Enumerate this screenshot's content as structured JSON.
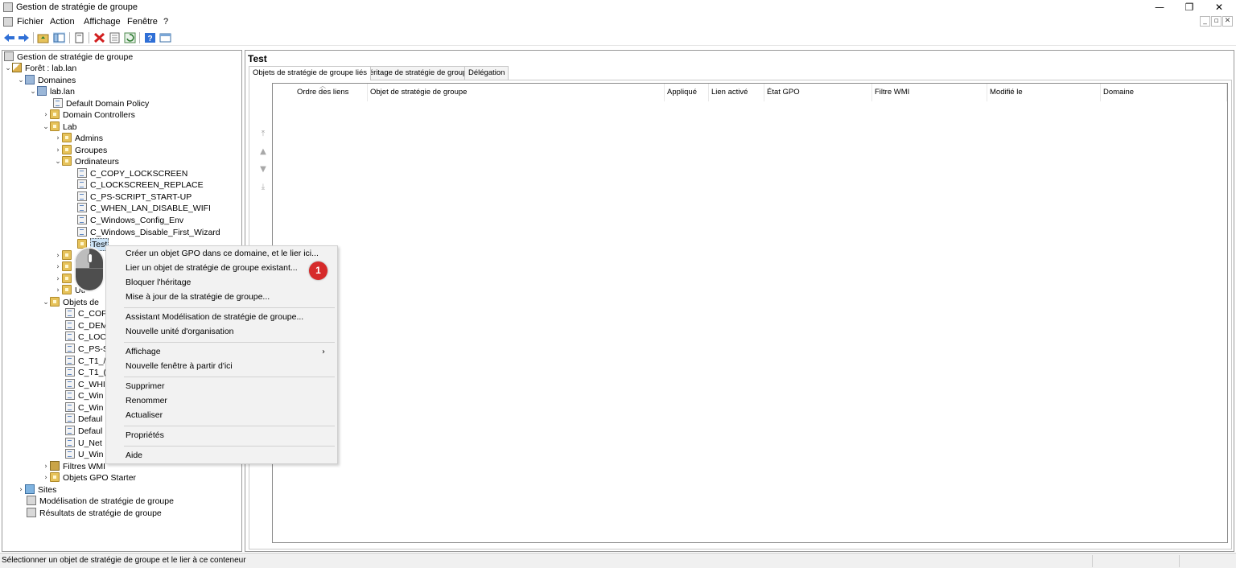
{
  "window": {
    "title": "Gestion de stratégie de groupe",
    "controls": {
      "minimize": "—",
      "restore": "❐",
      "close": "✕"
    }
  },
  "menubar": {
    "items": [
      "Fichier",
      "Action",
      "Affichage",
      "Fenêtre",
      "?"
    ],
    "mdi_controls": [
      "_",
      "▫",
      "✕"
    ]
  },
  "toolbar": {
    "buttons": [
      "back-arrow-icon",
      "forward-arrow-icon",
      "up-folder-icon",
      "show-tree-icon",
      "copy-icon",
      "delete-icon",
      "properties-icon",
      "refresh-icon",
      "help-icon",
      "console-icon"
    ]
  },
  "tree": {
    "root": "Gestion de stratégie de groupe",
    "forest": "Forêt : lab.lan",
    "domains": "Domaines",
    "domain": "lab.lan",
    "default_policy": "Default Domain Policy",
    "domain_controllers": "Domain Controllers",
    "lab": "Lab",
    "admins": "Admins",
    "groupes": "Groupes",
    "ordinateurs": "Ordinateurs",
    "ordinateurs_gpos": [
      "C_COPY_LOCKSCREEN",
      "C_LOCKSCREEN_REPLACE",
      "C_PS-SCRIPT_START-UP",
      "C_WHEN_LAN_DISABLE_WIFI",
      "C_Windows_Config_Env",
      "C_Windows_Disable_First_Wizard"
    ],
    "selected": "Test",
    "partial_hidden_3": "Ut",
    "partial_hidden_4": "Ut",
    "partial_last": "Uti",
    "objets_de": "Objets de",
    "objets_partial": [
      "C_COF",
      "C_DEM",
      "C_LOC",
      "C_PS-S",
      "C_T1_/",
      "C_T1_(",
      "C_WHI",
      "C_Win",
      "C_Win",
      "Defaul",
      "Defaul",
      "U_Net",
      "U_Win"
    ],
    "filtres_wmi": "Filtres WMI",
    "objets_gpo_starter": "Objets GPO Starter",
    "sites": "Sites",
    "modelisation": "Modélisation de stratégie de groupe",
    "resultats": "Résultats de stratégie de groupe"
  },
  "right_pane": {
    "title": "Test",
    "tabs": [
      "Objets de stratégie de groupe liés",
      "Héritage de stratégie de groupe",
      "Délégation"
    ],
    "columns": [
      "Ordre des liens",
      "Objet de stratégie de groupe",
      "Appliqué",
      "Lien activé",
      "État GPO",
      "Filtre WMI",
      "Modifié le",
      "Domaine"
    ],
    "order_arrows": [
      "⤒",
      "▲",
      "▼",
      "⤓"
    ]
  },
  "context_menu": {
    "items": [
      "Créer un objet GPO dans ce domaine, et le lier ici...",
      "Lier un objet de stratégie de groupe existant...",
      "Bloquer l'héritage",
      "Mise à jour de la stratégie de groupe...",
      "Assistant Modélisation de stratégie de groupe...",
      "Nouvelle unité d'organisation",
      "Affichage",
      "Nouvelle fenêtre à partir d'ici",
      "Supprimer",
      "Renommer",
      "Actualiser",
      "Propriétés",
      "Aide"
    ],
    "submenu_arrow": "›",
    "step_badge": "1",
    "badge_color": "#d62a2a"
  },
  "statusbar": {
    "text": "Sélectionner un objet de stratégie de groupe et le lier à ce conteneur"
  }
}
